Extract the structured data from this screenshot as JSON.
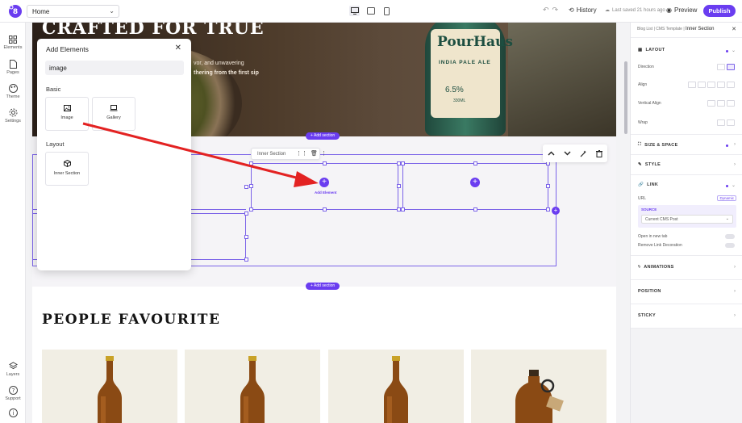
{
  "topbar": {
    "page_name": "Home",
    "history_label": "History",
    "saved_text": "Last saved 21 hours ago",
    "preview_label": "Preview",
    "publish_label": "Publish"
  },
  "leftbar": {
    "items": [
      {
        "label": "Elements",
        "icon": "grid-icon"
      },
      {
        "label": "Pages",
        "icon": "file-icon"
      },
      {
        "label": "Theme",
        "icon": "palette-icon"
      },
      {
        "label": "Settings",
        "icon": "gear-icon"
      }
    ],
    "bottom": [
      {
        "label": "Layers",
        "icon": "layers-icon"
      },
      {
        "label": "Support",
        "icon": "help-icon"
      },
      {
        "label": "",
        "icon": "info-icon"
      }
    ]
  },
  "hero": {
    "title": "CRAFTED FOR TRUE",
    "text_line1": "vor, and unwavering",
    "text_line2": "thering from the first sip",
    "bottle_brand": "PourHaus",
    "bottle_style": "INDIA PALE ALE",
    "bottle_abv": "6.5%",
    "bottle_vol": "330ML"
  },
  "builder": {
    "add_section_label": "+ Add section",
    "inner_section_label": "Inner Section",
    "add_element_label": "Add Element"
  },
  "main": {
    "section_title": "PEOPLE FAVOURITE"
  },
  "add_panel": {
    "title": "Add Elements",
    "search_value": "image",
    "sections": [
      {
        "title": "Basic",
        "items": [
          {
            "label": "Image",
            "icon": "image-icon"
          },
          {
            "label": "Gallery",
            "icon": "gallery-icon"
          }
        ]
      },
      {
        "title": "Layout",
        "items": [
          {
            "label": "Inner Section",
            "icon": "cube-icon"
          }
        ]
      }
    ]
  },
  "rightpanel": {
    "breadcrumb": [
      "Blog List",
      "CMS Template",
      "Inner Section"
    ],
    "layout_head": "LAYOUT",
    "direction_label": "Direction",
    "align_label": "Align",
    "vertical_align_label": "Vertical Align",
    "wrap_label": "Wrap",
    "size_head": "SIZE & SPACE",
    "style_head": "STYLE",
    "link_head": "LINK",
    "url_label": "URL",
    "dynamic_label": "Dynamic",
    "source_label": "SOURCE",
    "source_value": "Current CMS Post",
    "open_new_tab": "Open in new tab",
    "remove_decoration": "Remove Link Decoration",
    "animations_head": "ANIMATIONS",
    "position_head": "POSITION",
    "sticky_head": "STICKY"
  },
  "colors": {
    "accent": "#6a3df0",
    "arrow": "#e32222"
  }
}
